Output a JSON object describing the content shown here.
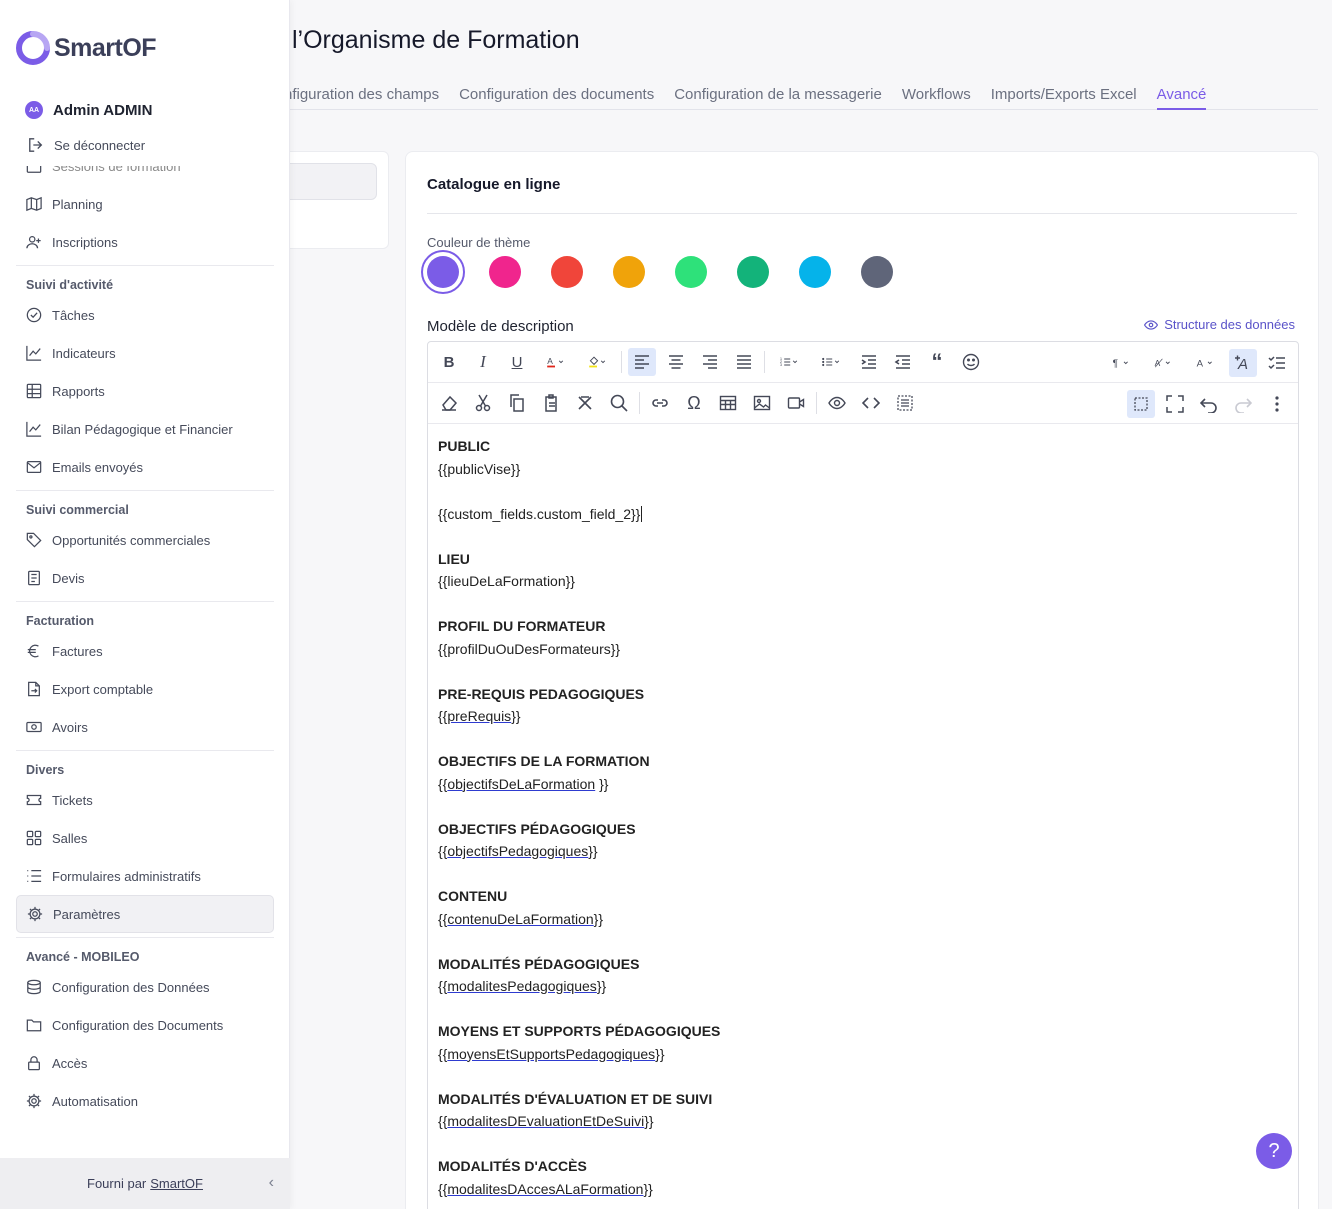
{
  "page": {
    "title": "l’Organisme de Formation"
  },
  "tabs": [
    {
      "label": "nfiguration des champs",
      "active": false
    },
    {
      "label": "Configuration des documents",
      "active": false
    },
    {
      "label": "Configuration de la messagerie",
      "active": false
    },
    {
      "label": "Workflows",
      "active": false
    },
    {
      "label": "Imports/Exports Excel",
      "active": false
    },
    {
      "label": "Avancé",
      "active": true
    }
  ],
  "card": {
    "title": "Catalogue en ligne",
    "theme_label": "Couleur de thème",
    "theme_colors": [
      "#7b5ce7",
      "#f0258d",
      "#f0453a",
      "#f0a30a",
      "#2ee17a",
      "#13b37a",
      "#05b3ea",
      "#5f6579"
    ],
    "selected_color": 0,
    "description_label": "Modèle de description",
    "structure_link": "Structure des données"
  },
  "editor": {
    "lines": [
      {
        "text": "PUBLIC",
        "type": "h"
      },
      {
        "text": "{{publicVise}}",
        "type": "p"
      },
      {
        "text": "",
        "type": "blank"
      },
      {
        "text": "{{custom_fields.custom_field_2}}",
        "type": "p",
        "caret": true
      },
      {
        "text": "",
        "type": "blank"
      },
      {
        "text": "LIEU",
        "type": "h"
      },
      {
        "text": "{{lieuDeLaFormation}}",
        "type": "p"
      },
      {
        "text": "",
        "type": "blank"
      },
      {
        "text": "PROFIL DU FORMATEUR",
        "type": "h"
      },
      {
        "text": "{{profilDuOuDesFormateurs}}",
        "type": "p"
      },
      {
        "text": "",
        "type": "blank"
      },
      {
        "text": "PRE-REQUIS PEDAGOGIQUES",
        "type": "h"
      },
      {
        "text": "{{",
        "type": "p",
        "u": "preRequis",
        "after": "}}"
      },
      {
        "text": "",
        "type": "blank"
      },
      {
        "text": "OBJECTIFS DE LA FORMATION",
        "type": "h"
      },
      {
        "text": "{{",
        "type": "p",
        "u": "objectifsDeLaFormation",
        "after": " }}"
      },
      {
        "text": "",
        "type": "blank"
      },
      {
        "text": "OBJECTIFS PÉDAGOGIQUES",
        "type": "h"
      },
      {
        "text": "{{",
        "type": "p",
        "u": "objectifsPedagogiques",
        "after": "}}"
      },
      {
        "text": "",
        "type": "blank"
      },
      {
        "text": "CONTENU",
        "type": "h"
      },
      {
        "text": "{{",
        "type": "p",
        "u": "contenuDeLaFormation",
        "after": "}}"
      },
      {
        "text": "",
        "type": "blank"
      },
      {
        "text": "MODALITÉS PÉDAGOGIQUES",
        "type": "h"
      },
      {
        "text": "{{",
        "type": "p",
        "u": "modalitesPedagogiques",
        "after": "}}"
      },
      {
        "text": "",
        "type": "blank"
      },
      {
        "text": "MOYENS ET SUPPORTS PÉDAGOGIQUES",
        "type": "h"
      },
      {
        "text": "{{",
        "type": "p",
        "u": "moyensEtSupportsPedagogiques",
        "after": "}}"
      },
      {
        "text": "",
        "type": "blank"
      },
      {
        "text": "MODALITÉS D'ÉVALUATION ET DE SUIVI",
        "type": "h"
      },
      {
        "text": "{{",
        "type": "p",
        "u": "modalitesDEvaluationEtDeSuivi",
        "after": "}}"
      },
      {
        "text": "",
        "type": "blank"
      },
      {
        "text": "MODALITÉS D'ACCÈS",
        "type": "h"
      },
      {
        "text": "{{",
        "type": "p",
        "u": "modalitesDAccesALaFormation",
        "after": "}}"
      }
    ]
  },
  "help": {
    "label": "?"
  },
  "sidebar": {
    "logo": "SmartOF",
    "user": {
      "initials": "AA",
      "name": "Admin ADMIN"
    },
    "logout": "Se déconnecter",
    "partial_item": "Sessions de formation",
    "groups": [
      {
        "title": "",
        "items": [
          {
            "label": "Planning",
            "icon": "map-icon"
          },
          {
            "label": "Inscriptions",
            "icon": "user-plus-icon"
          }
        ]
      },
      {
        "title": "Suivi d'activité",
        "items": [
          {
            "label": "Tâches",
            "icon": "check-circle-icon"
          },
          {
            "label": "Indicateurs",
            "icon": "chart-line-icon"
          },
          {
            "label": "Rapports",
            "icon": "grid-icon"
          },
          {
            "label": "Bilan Pédagogique et Financier",
            "icon": "chart-line-icon"
          },
          {
            "label": "Emails envoyés",
            "icon": "mail-icon"
          }
        ]
      },
      {
        "title": "Suivi commercial",
        "items": [
          {
            "label": "Opportunités commerciales",
            "icon": "tag-icon"
          },
          {
            "label": "Devis",
            "icon": "document-icon"
          }
        ]
      },
      {
        "title": "Facturation",
        "items": [
          {
            "label": "Factures",
            "icon": "euro-icon"
          },
          {
            "label": "Export comptable",
            "icon": "file-export-icon"
          },
          {
            "label": "Avoirs",
            "icon": "banknote-icon"
          }
        ]
      },
      {
        "title": "Divers",
        "items": [
          {
            "label": "Tickets",
            "icon": "ticket-icon"
          },
          {
            "label": "Salles",
            "icon": "squares-icon"
          },
          {
            "label": "Formulaires administratifs",
            "icon": "list-icon"
          },
          {
            "label": "Paramètres",
            "icon": "gear-icon",
            "active": true
          }
        ]
      },
      {
        "title": "Avancé - MOBILEO",
        "items": [
          {
            "label": "Configuration des Données",
            "icon": "database-icon"
          },
          {
            "label": "Configuration des Documents",
            "icon": "folder-icon"
          },
          {
            "label": "Accès",
            "icon": "lock-icon"
          },
          {
            "label": "Automatisation",
            "icon": "gear-icon"
          }
        ]
      }
    ],
    "footer": {
      "prefix": "Fourni par",
      "link": "SmartOF"
    }
  }
}
